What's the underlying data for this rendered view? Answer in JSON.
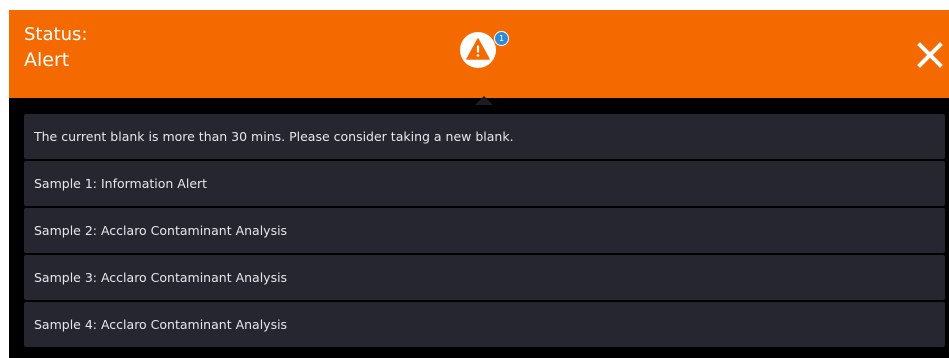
{
  "header": {
    "status_label": "Status:",
    "status_value": "Alert",
    "alert_badge_count": "1",
    "icons": {
      "alert": "warning-triangle-icon",
      "close": "close-icon"
    },
    "colors": {
      "header_background": "#f46a00",
      "badge": "#2f8ad9",
      "list_background": "#000000",
      "item_background": "#262630"
    }
  },
  "messages": [
    "The current blank is more than 30 mins. Please consider taking a new blank.",
    "Sample 1: Information Alert",
    "Sample 2: Acclaro Contaminant Analysis",
    "Sample 3: Acclaro Contaminant Analysis",
    "Sample 4: Acclaro Contaminant Analysis"
  ]
}
